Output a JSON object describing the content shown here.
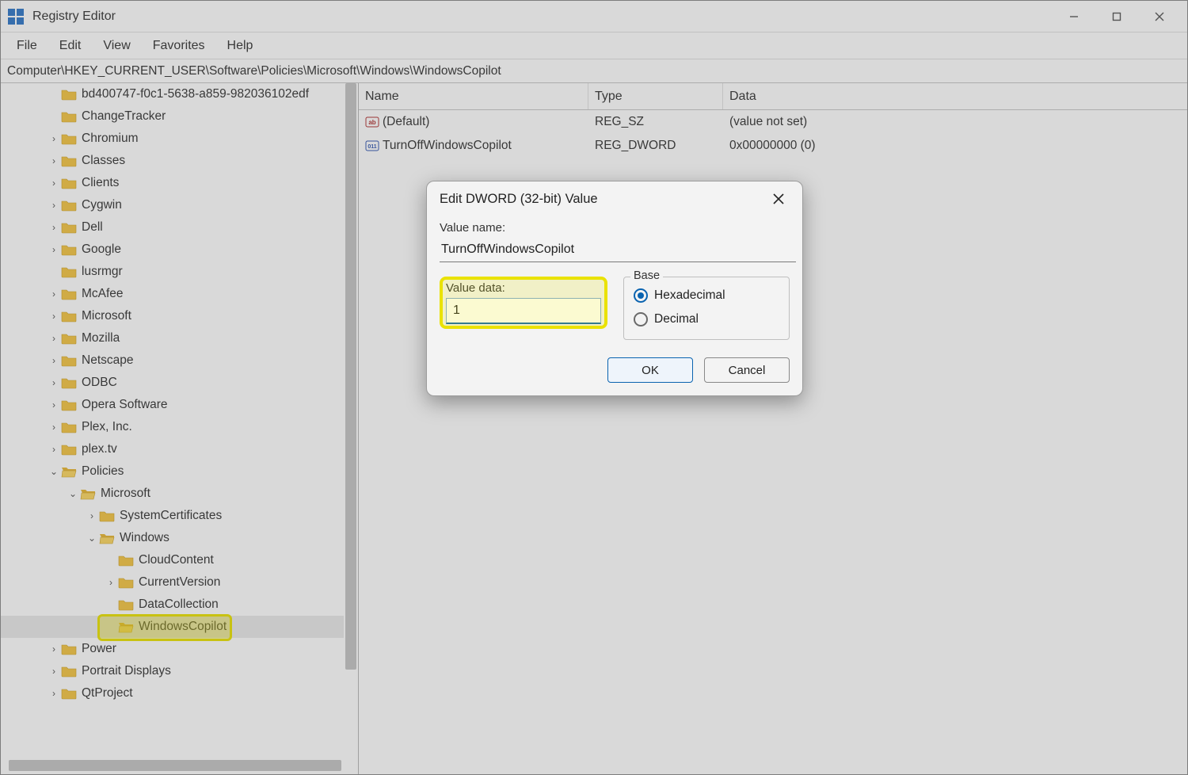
{
  "title": "Registry Editor",
  "menu": [
    "File",
    "Edit",
    "View",
    "Favorites",
    "Help"
  ],
  "address": "Computer\\HKEY_CURRENT_USER\\Software\\Policies\\Microsoft\\Windows\\WindowsCopilot",
  "tree": [
    {
      "indent": 2,
      "chev": "",
      "label": "bd400747-f0c1-5638-a859-982036102edf"
    },
    {
      "indent": 2,
      "chev": "",
      "label": "ChangeTracker"
    },
    {
      "indent": 2,
      "chev": ">",
      "label": "Chromium"
    },
    {
      "indent": 2,
      "chev": ">",
      "label": "Classes"
    },
    {
      "indent": 2,
      "chev": ">",
      "label": "Clients"
    },
    {
      "indent": 2,
      "chev": ">",
      "label": "Cygwin"
    },
    {
      "indent": 2,
      "chev": ">",
      "label": "Dell"
    },
    {
      "indent": 2,
      "chev": ">",
      "label": "Google"
    },
    {
      "indent": 2,
      "chev": "",
      "label": "lusrmgr"
    },
    {
      "indent": 2,
      "chev": ">",
      "label": "McAfee"
    },
    {
      "indent": 2,
      "chev": ">",
      "label": "Microsoft"
    },
    {
      "indent": 2,
      "chev": ">",
      "label": "Mozilla"
    },
    {
      "indent": 2,
      "chev": ">",
      "label": "Netscape"
    },
    {
      "indent": 2,
      "chev": ">",
      "label": "ODBC"
    },
    {
      "indent": 2,
      "chev": ">",
      "label": "Opera Software"
    },
    {
      "indent": 2,
      "chev": ">",
      "label": "Plex, Inc."
    },
    {
      "indent": 2,
      "chev": ">",
      "label": "plex.tv"
    },
    {
      "indent": 2,
      "chev": "v",
      "label": "Policies"
    },
    {
      "indent": 3,
      "chev": "v",
      "label": "Microsoft"
    },
    {
      "indent": 4,
      "chev": ">",
      "label": "SystemCertificates"
    },
    {
      "indent": 4,
      "chev": "v",
      "label": "Windows"
    },
    {
      "indent": 5,
      "chev": "",
      "label": "CloudContent"
    },
    {
      "indent": 5,
      "chev": ">",
      "label": "CurrentVersion"
    },
    {
      "indent": 5,
      "chev": "",
      "label": "DataCollection"
    },
    {
      "indent": 5,
      "chev": "",
      "label": "WindowsCopilot",
      "selected": true
    },
    {
      "indent": 2,
      "chev": ">",
      "label": "Power"
    },
    {
      "indent": 2,
      "chev": ">",
      "label": "Portrait Displays"
    },
    {
      "indent": 2,
      "chev": ">",
      "label": "QtProject"
    }
  ],
  "columns": {
    "name": "Name",
    "type": "Type",
    "data": "Data"
  },
  "values": [
    {
      "icon": "sz",
      "name": "(Default)",
      "type": "REG_SZ",
      "data": "(value not set)"
    },
    {
      "icon": "dword",
      "name": "TurnOffWindowsCopilot",
      "type": "REG_DWORD",
      "data": "0x00000000 (0)"
    }
  ],
  "dialog": {
    "title": "Edit DWORD (32-bit) Value",
    "value_name_label": "Value name:",
    "value_name": "TurnOffWindowsCopilot",
    "value_data_label": "Value data:",
    "value_data": "1",
    "base_label": "Base",
    "hex_label": "Hexadecimal",
    "dec_label": "Decimal",
    "selected_base": "hex",
    "ok": "OK",
    "cancel": "Cancel"
  }
}
